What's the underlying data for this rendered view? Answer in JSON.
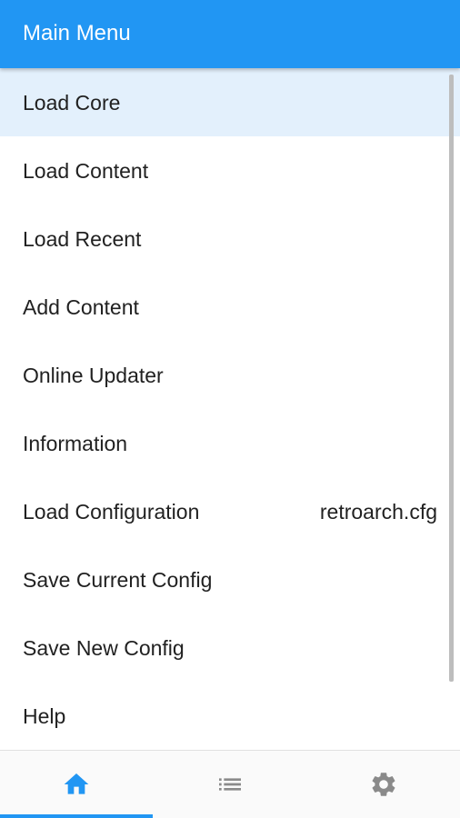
{
  "header": {
    "title": "Main Menu"
  },
  "menu": {
    "items": [
      {
        "label": "Load Core",
        "value": ""
      },
      {
        "label": "Load Content",
        "value": ""
      },
      {
        "label": "Load Recent",
        "value": ""
      },
      {
        "label": "Add Content",
        "value": ""
      },
      {
        "label": "Online Updater",
        "value": ""
      },
      {
        "label": "Information",
        "value": ""
      },
      {
        "label": "Load Configuration",
        "value": "retroarch.cfg"
      },
      {
        "label": "Save Current Config",
        "value": ""
      },
      {
        "label": "Save New Config",
        "value": ""
      },
      {
        "label": "Help",
        "value": ""
      }
    ]
  },
  "bottom_nav": {
    "tabs": [
      {
        "icon": "home-icon",
        "active": true
      },
      {
        "icon": "list-icon",
        "active": false
      },
      {
        "icon": "gear-icon",
        "active": false
      }
    ]
  },
  "colors": {
    "accent": "#2196f3",
    "selected_bg": "#e3f0fc",
    "inactive_icon": "#8a8a8a"
  }
}
